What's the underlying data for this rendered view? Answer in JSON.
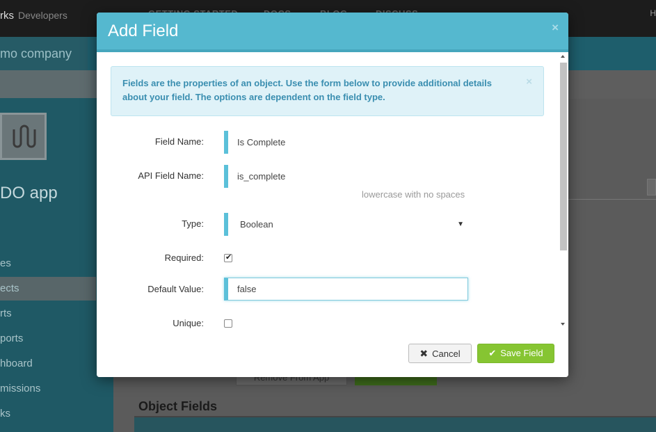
{
  "background": {
    "brand": "rks",
    "brand_sub": "Developers",
    "nav": [
      "GETTING STARTED",
      "DOCS",
      "BLOG",
      "DISCUSS"
    ],
    "nav_right": "H",
    "company": "mo company",
    "app_name": "DO app",
    "sidebar_items": [
      "es",
      "ects",
      "rts",
      "ports",
      "hboard",
      "missions",
      "ks"
    ],
    "remove_button": "Remove From App",
    "object_fields_heading": "Object Fields"
  },
  "modal": {
    "title": "Add Field",
    "close_glyph": "×",
    "alert_text": "Fields are the properties of an object. Use the form below to provide additional details about your field. The options are dependent on the field type.",
    "alert_close_glyph": "×",
    "fields": {
      "field_name_label": "Field Name:",
      "field_name_value": "Is Complete",
      "api_name_label": "API Field Name:",
      "api_name_value": "is_complete",
      "api_name_help": "lowercase with no spaces",
      "type_label": "Type:",
      "type_value": "Boolean",
      "required_label": "Required:",
      "required_checked": true,
      "default_label": "Default Value:",
      "default_value": "false",
      "unique_label": "Unique:",
      "unique_checked": false
    },
    "footer": {
      "cancel_label": "Cancel",
      "save_label": "Save Field"
    }
  },
  "colors": {
    "header": "#55b8cf",
    "accent": "#5bc0d9",
    "save": "#86c532"
  }
}
